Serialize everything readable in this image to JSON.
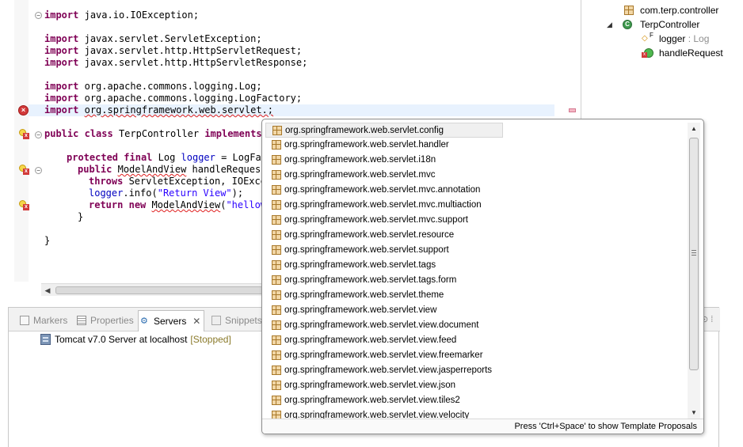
{
  "editor": {
    "imports": [
      "java.io.IOException;",
      "javax.servlet.ServletException;",
      "javax.servlet.http.HttpServletRequest;",
      "javax.servlet.http.HttpServletResponse;",
      "org.apache.commons.logging.Log;",
      "org.apache.commons.logging.LogFactory;",
      "org.springframework.web.servlet.;"
    ],
    "kw_import": "import",
    "kw_public": "public",
    "kw_class": "class",
    "kw_implements": "implements",
    "kw_protected": "protected",
    "kw_final": "final",
    "kw_throws": "throws",
    "kw_return": "return",
    "kw_new": "new",
    "class_name": " TerpController ",
    "field_type": " Log ",
    "field_name": "logger",
    "field_init": " = LogFac",
    "method_type": "ModelAndView",
    "method_rest": " handleRequest",
    "throws_rest": " ServletException, IOExce",
    "log_call": ".info(",
    "log_string": "\"Return View\"",
    "log_end": ");",
    "return_type": "ModelAndView",
    "return_paren": "(",
    "return_string": "\"hellow",
    "close_brace_inner": "}",
    "close_brace_outer": "}"
  },
  "outline": {
    "package": "com.terp.controller",
    "class": "TerpController",
    "field_name": "logger",
    "field_type": " : Log",
    "field_marker": "F",
    "method": "handleRequest"
  },
  "bottom_panel": {
    "tabs": [
      {
        "label": "Markers",
        "icon": "markers-icon"
      },
      {
        "label": "Properties",
        "icon": "properties-icon"
      },
      {
        "label": "Servers",
        "icon": "servers-icon"
      },
      {
        "label": "Snippets",
        "icon": "snippets-icon"
      }
    ],
    "server": {
      "name": "Tomcat v7.0 Server at localhost",
      "state": "[Stopped]"
    }
  },
  "content_assist": {
    "proposals": [
      "org.springframework.web.servlet.config",
      "org.springframework.web.servlet.handler",
      "org.springframework.web.servlet.i18n",
      "org.springframework.web.servlet.mvc",
      "org.springframework.web.servlet.mvc.annotation",
      "org.springframework.web.servlet.mvc.multiaction",
      "org.springframework.web.servlet.mvc.support",
      "org.springframework.web.servlet.resource",
      "org.springframework.web.servlet.support",
      "org.springframework.web.servlet.tags",
      "org.springframework.web.servlet.tags.form",
      "org.springframework.web.servlet.theme",
      "org.springframework.web.servlet.view",
      "org.springframework.web.servlet.view.document",
      "org.springframework.web.servlet.view.feed",
      "org.springframework.web.servlet.view.freemarker",
      "org.springframework.web.servlet.view.jasperreports",
      "org.springframework.web.servlet.view.json",
      "org.springframework.web.servlet.view.tiles2",
      "org.springframework.web.servlet.view.velocity"
    ],
    "selected_index": 0,
    "status": "Press 'Ctrl+Space' to show Template Proposals"
  }
}
